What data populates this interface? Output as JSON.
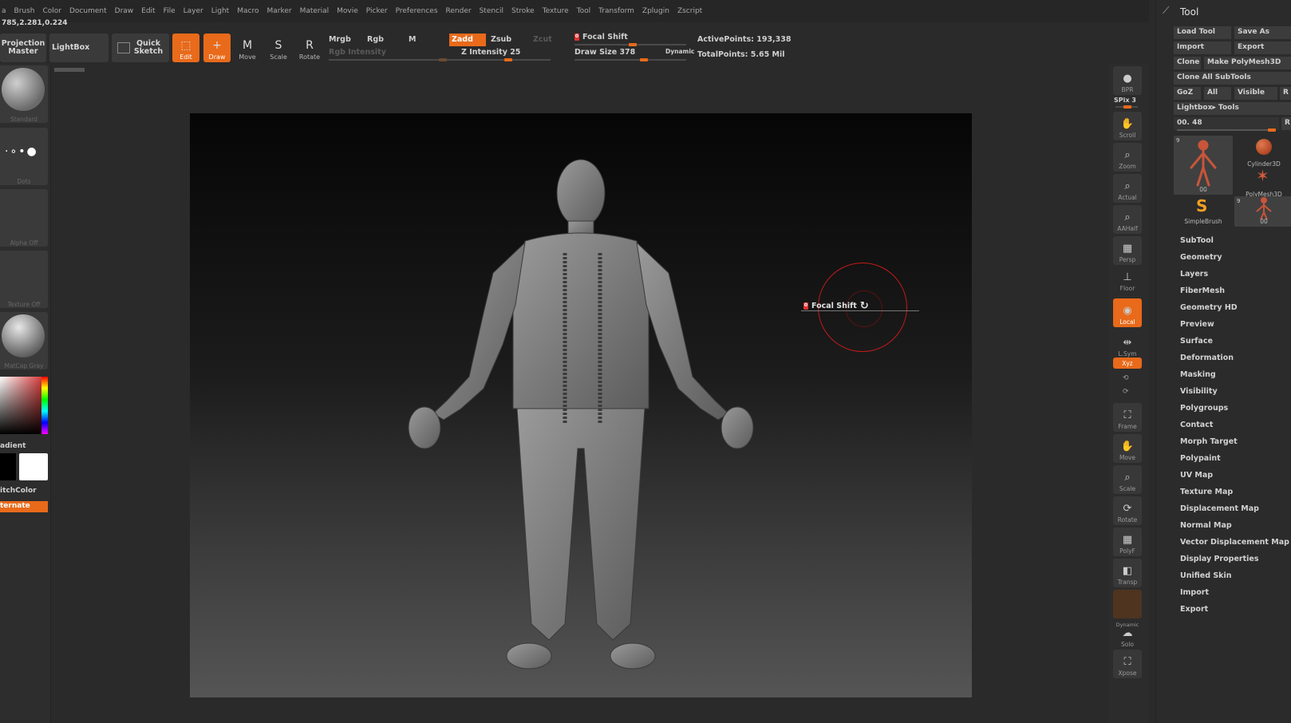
{
  "menu": [
    "a",
    "Brush",
    "Color",
    "Document",
    "Draw",
    "Edit",
    "File",
    "Layer",
    "Light",
    "Macro",
    "Marker",
    "Material",
    "Movie",
    "Picker",
    "Preferences",
    "Render",
    "Stencil",
    "Stroke",
    "Texture",
    "Tool",
    "Transform",
    "Zplugin",
    "Zscript"
  ],
  "coords": "785,2.281,0.224",
  "toolbar": {
    "projection": "Projection Master",
    "lightbox": "LightBox",
    "quick_sketch": "Quick Sketch",
    "edit": "Edit",
    "draw": "Draw",
    "move": "Move",
    "scale": "Scale",
    "rotate": "Rotate",
    "mrgb": "Mrgb",
    "rgb": "Rgb",
    "m": "M",
    "zadd": "Zadd",
    "zsub": "Zsub",
    "zcut": "Zcut",
    "rgb_intensity": "Rgb Intensity",
    "z_intensity": "Z Intensity 25",
    "focal_shift": "Focal Shift",
    "focal_value": "0",
    "draw_size": "Draw Size 378",
    "dynamic": "Dynamic",
    "active_points": "ActivePoints: 193,338",
    "total_points": "TotalPoints: 5.65 Mil"
  },
  "left": {
    "standard": "Standard",
    "dots": "Dots",
    "alpha": "Alpha Off",
    "texture": "Texture Off",
    "matcap": "MatCap Gray",
    "gradient": "adient",
    "switch": "itchColor",
    "alternate": "ternate"
  },
  "cursor": {
    "value": "0",
    "label": "Focal Shift"
  },
  "right_tools": [
    "BPR",
    "SPix 3",
    "Scroll",
    "Zoom",
    "Actual",
    "AAHalf",
    "Persp",
    "Floor",
    "Local",
    "L.Sym",
    "Xyz",
    "Frame",
    "Move",
    "Scale",
    "Rotate",
    "PolyF",
    "Transp",
    "Dynamic",
    "Solo",
    "Xpose"
  ],
  "tool": {
    "title": "Tool",
    "load": "Load Tool",
    "save": "Save As",
    "import": "Import",
    "export": "Export",
    "clone": "Clone",
    "make": "Make PolyMesh3D",
    "clone_all": "Clone All SubTools",
    "goz": "GoZ",
    "all": "All",
    "visible": "Visible",
    "r": "R",
    "lightbox_tools": "Lightbox▸ Tools",
    "value": "00. 48",
    "r2": "R",
    "thumbs": [
      "00",
      "Cylinder3D",
      "PolyMesh3D",
      "SimpleBrush",
      "00"
    ],
    "counts": [
      "9",
      "9"
    ]
  },
  "sections": [
    "SubTool",
    "Geometry",
    "Layers",
    "FiberMesh",
    "Geometry HD",
    "Preview",
    "Surface",
    "Deformation",
    "Masking",
    "Visibility",
    "Polygroups",
    "Contact",
    "Morph Target",
    "Polypaint",
    "UV Map",
    "Texture Map",
    "Displacement Map",
    "Normal Map",
    "Vector Displacement Map",
    "Display Properties",
    "Unified Skin",
    "Import",
    "Export"
  ]
}
